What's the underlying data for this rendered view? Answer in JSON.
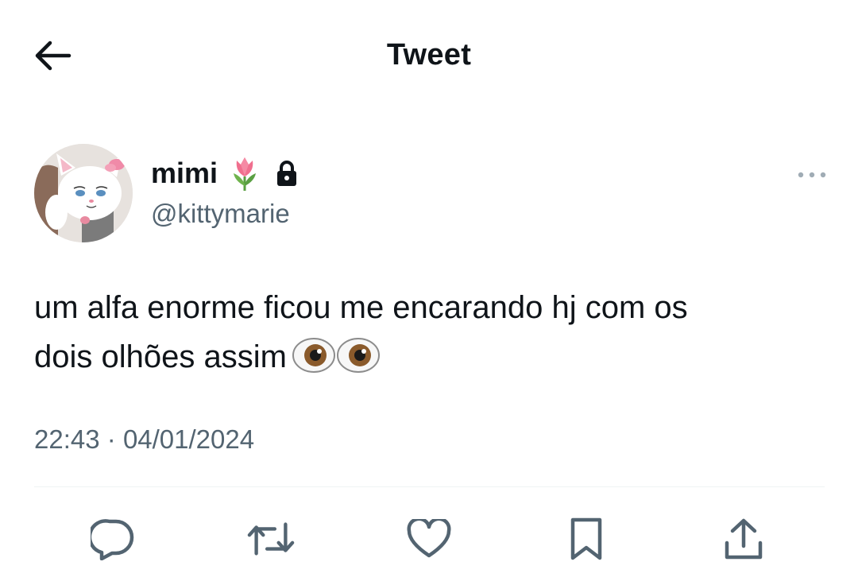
{
  "header": {
    "title": "Tweet",
    "back_icon": "arrow-left-icon"
  },
  "tweet": {
    "author": {
      "display_name": "mimi",
      "name_emoji": "tulip-icon",
      "protected_icon": "lock-icon",
      "handle": "@kittymarie"
    },
    "more_icon": "more-horizontal-icon",
    "text_line1": "um alfa enorme ficou me encarando hj com os",
    "text_line2": "dois olhões assim",
    "text_emoji": "eyes-icon",
    "time": "22:43",
    "separator": "·",
    "date": "04/01/2024"
  },
  "actions": [
    {
      "name": "reply",
      "icon": "reply-icon"
    },
    {
      "name": "retweet",
      "icon": "retweet-icon"
    },
    {
      "name": "like",
      "icon": "heart-icon"
    },
    {
      "name": "bookmark",
      "icon": "bookmark-icon"
    },
    {
      "name": "share",
      "icon": "share-icon"
    }
  ],
  "colors": {
    "text_primary": "#0f1419",
    "text_secondary": "#536471",
    "divider": "#eff3f4"
  }
}
